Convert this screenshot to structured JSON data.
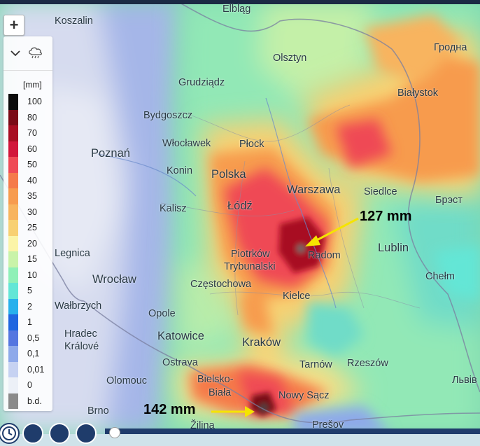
{
  "map": {
    "places": [
      {
        "id": "koszalin",
        "name": "Koszalin"
      },
      {
        "id": "elblag",
        "name": "Elbląg"
      },
      {
        "id": "olsztyn",
        "name": "Olsztyn"
      },
      {
        "id": "grodno",
        "name": "Гродна"
      },
      {
        "id": "grudziadz",
        "name": "Grudziądz"
      },
      {
        "id": "bialystok",
        "name": "Białystok"
      },
      {
        "id": "bydgoszcz",
        "name": "Bydgoszcz"
      },
      {
        "id": "poznan",
        "name": "Poznań"
      },
      {
        "id": "wloclawek",
        "name": "Włocławek"
      },
      {
        "id": "plock",
        "name": "Płock"
      },
      {
        "id": "konin",
        "name": "Konin"
      },
      {
        "id": "polska",
        "name": "Polska"
      },
      {
        "id": "warszawa",
        "name": "Warszawa"
      },
      {
        "id": "siedlce",
        "name": "Siedlce"
      },
      {
        "id": "brest",
        "name": "Брэст"
      },
      {
        "id": "kalisz",
        "name": "Kalisz"
      },
      {
        "id": "lodz",
        "name": "Łódź"
      },
      {
        "id": "legnica",
        "name": "Legnica"
      },
      {
        "id": "piotrkow",
        "name": "Piotrków"
      },
      {
        "id": "trybunalski",
        "name": "Trybunalski"
      },
      {
        "id": "radom",
        "name": "Radom"
      },
      {
        "id": "lublin",
        "name": "Lublin"
      },
      {
        "id": "wroclaw",
        "name": "Wrocław"
      },
      {
        "id": "czestochowa",
        "name": "Częstochowa"
      },
      {
        "id": "chelm",
        "name": "Chełm"
      },
      {
        "id": "walbrzych",
        "name": "Wałbrzych"
      },
      {
        "id": "kielce",
        "name": "Kielce"
      },
      {
        "id": "opole",
        "name": "Opole"
      },
      {
        "id": "hradec",
        "name": "Hradec"
      },
      {
        "id": "kralove",
        "name": "Králové"
      },
      {
        "id": "katowice",
        "name": "Katowice"
      },
      {
        "id": "krakow",
        "name": "Kraków"
      },
      {
        "id": "ostrava",
        "name": "Ostrava"
      },
      {
        "id": "tarnow",
        "name": "Tarnów"
      },
      {
        "id": "rzeszow",
        "name": "Rzeszów"
      },
      {
        "id": "olomouc",
        "name": "Olomouc"
      },
      {
        "id": "bielsko",
        "name": "Bielsko-"
      },
      {
        "id": "biala",
        "name": "Biała"
      },
      {
        "id": "lviv",
        "name": "Львів"
      },
      {
        "id": "nowysacz",
        "name": "Nowy Sącz"
      },
      {
        "id": "brno",
        "name": "Brno"
      },
      {
        "id": "zilina",
        "name": "Žilina"
      },
      {
        "id": "presov",
        "name": "Prešov"
      }
    ],
    "annotations": [
      {
        "id": "radom-max",
        "text": "127 mm",
        "color": "#f5e400"
      },
      {
        "id": "tatra-max",
        "text": "142 mm",
        "color": "#f5e400"
      }
    ]
  },
  "controls": {
    "zoom_in_label": "+",
    "layer_icon": "rain-cloud-icon",
    "collapse_icon": "chevron-down-icon",
    "play_controls": [
      "clock-icon",
      "rewind-icon",
      "play-icon",
      "fast-forward-icon"
    ]
  },
  "legend": {
    "unit": "[mm]",
    "items": [
      {
        "label": "100",
        "color": "#0b0b0b"
      },
      {
        "label": "80",
        "color": "#7a0a16"
      },
      {
        "label": "70",
        "color": "#a80e22"
      },
      {
        "label": "60",
        "color": "#d2163a"
      },
      {
        "label": "50",
        "color": "#ef4a55"
      },
      {
        "label": "40",
        "color": "#f57a4a"
      },
      {
        "label": "35",
        "color": "#f79b4e"
      },
      {
        "label": "30",
        "color": "#f8b45e"
      },
      {
        "label": "25",
        "color": "#f8d072"
      },
      {
        "label": "20",
        "color": "#fbf4a7"
      },
      {
        "label": "15",
        "color": "#c9f3a9"
      },
      {
        "label": "10",
        "color": "#8ff0b7"
      },
      {
        "label": "5",
        "color": "#63e6d6"
      },
      {
        "label": "2",
        "color": "#27b0ec"
      },
      {
        "label": "1",
        "color": "#1f66e0"
      },
      {
        "label": "0,5",
        "color": "#5576e0"
      },
      {
        "label": "0,1",
        "color": "#8ea9ea"
      },
      {
        "label": "0,01",
        "color": "#c6d2f2"
      },
      {
        "label": "0",
        "color": "#ecf0f7"
      },
      {
        "label": "b.d.",
        "color": "#8a8a8a"
      }
    ]
  }
}
